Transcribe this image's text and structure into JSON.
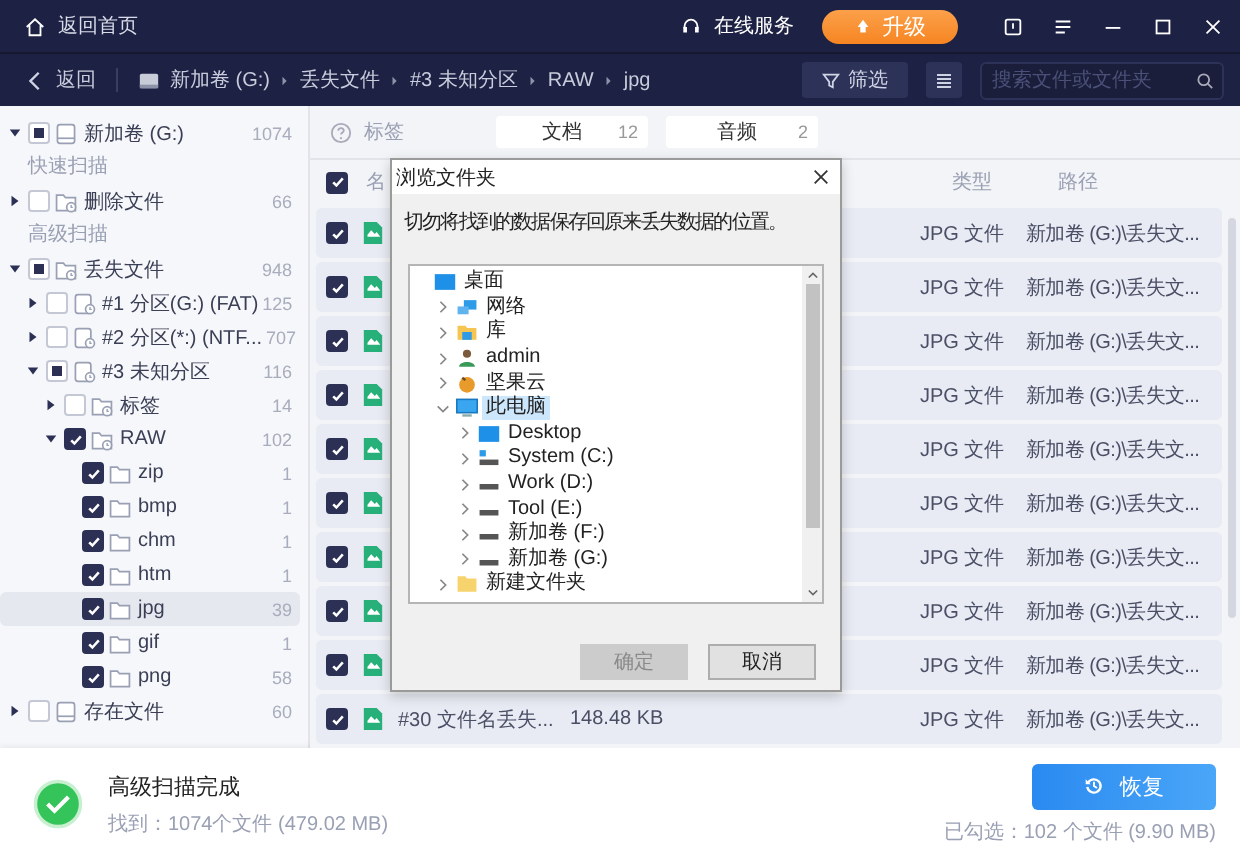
{
  "title_bar": {
    "home_link": "返回首页",
    "service": "在线服务",
    "upgrade_button": "升级"
  },
  "nav_bar": {
    "back": "返回",
    "breadcrumb": [
      "新加卷 (G:)",
      "丢失文件",
      "#3 未知分区",
      "RAW",
      "jpg"
    ],
    "filter_button": "筛选",
    "search": {
      "placeholder": "搜索文件或文件夹"
    }
  },
  "sidebar": {
    "items": [
      {
        "kind": "drive",
        "label": "新加卷 (G:)",
        "count": "1074",
        "partial": true,
        "expanded": true,
        "selected": false
      },
      {
        "kind": "heading",
        "label": "快速扫描"
      },
      {
        "kind": "folder-clock",
        "label": "删除文件",
        "count": "66",
        "checked": false,
        "expanded": false,
        "selected": false
      },
      {
        "kind": "heading",
        "label": "高级扫描"
      },
      {
        "kind": "folder-clock",
        "label": "丢失文件",
        "count": "948",
        "partial": true,
        "expanded": true,
        "selected": false,
        "children": [
          {
            "kind": "drive-clock",
            "label": "#1 分区(G:) (FAT)",
            "count": "125",
            "checked": false,
            "expanded": false,
            "selected": false
          },
          {
            "kind": "drive-clock",
            "label": "#2 分区(*:) (NTF...",
            "count": "707",
            "checked": false,
            "expanded": false,
            "selected": false
          },
          {
            "kind": "drive-clock",
            "label": "#3 未知分区",
            "count": "116",
            "partial": true,
            "expanded": true,
            "selected": false,
            "children": [
              {
                "kind": "folder-clock",
                "label": "标签",
                "count": "14",
                "checked": false,
                "expanded": false,
                "selected": false
              },
              {
                "kind": "folder-clock",
                "label": "RAW",
                "count": "102",
                "checked": true,
                "expanded": true,
                "selected": false,
                "children": [
                  {
                    "kind": "folder",
                    "label": "zip",
                    "count": "1",
                    "checked": true,
                    "selected": false
                  },
                  {
                    "kind": "folder",
                    "label": "bmp",
                    "count": "1",
                    "checked": true,
                    "selected": false
                  },
                  {
                    "kind": "folder",
                    "label": "chm",
                    "count": "1",
                    "checked": true,
                    "selected": false
                  },
                  {
                    "kind": "folder",
                    "label": "htm",
                    "count": "1",
                    "checked": true,
                    "selected": false
                  },
                  {
                    "kind": "folder",
                    "label": "jpg",
                    "count": "39",
                    "checked": true,
                    "selected": true
                  },
                  {
                    "kind": "folder",
                    "label": "gif",
                    "count": "1",
                    "checked": true,
                    "selected": false
                  },
                  {
                    "kind": "folder",
                    "label": "png",
                    "count": "58",
                    "checked": true,
                    "selected": false
                  }
                ]
              }
            ]
          }
        ]
      },
      {
        "kind": "drive",
        "label": "存在文件",
        "count": "60",
        "checked": false,
        "expanded": false,
        "selected": false
      }
    ]
  },
  "tags": {
    "label": "标签",
    "items": [
      {
        "label": "文档",
        "count": "12"
      },
      {
        "label": "音频",
        "count": "2"
      }
    ]
  },
  "table": {
    "all_checked": true,
    "columns": [
      "名",
      "类型",
      "路径"
    ],
    "rows": [
      {
        "checked": true,
        "type": "JPG 文件",
        "path": "新加卷 (G:)\\丢失文..."
      },
      {
        "checked": true,
        "type": "JPG 文件",
        "path": "新加卷 (G:)\\丢失文..."
      },
      {
        "checked": true,
        "type": "JPG 文件",
        "path": "新加卷 (G:)\\丢失文..."
      },
      {
        "checked": true,
        "type": "JPG 文件",
        "path": "新加卷 (G:)\\丢失文..."
      },
      {
        "checked": true,
        "type": "JPG 文件",
        "path": "新加卷 (G:)\\丢失文..."
      },
      {
        "checked": true,
        "type": "JPG 文件",
        "path": "新加卷 (G:)\\丢失文..."
      },
      {
        "checked": true,
        "type": "JPG 文件",
        "path": "新加卷 (G:)\\丢失文..."
      },
      {
        "checked": true,
        "type": "JPG 文件",
        "path": "新加卷 (G:)\\丢失文..."
      },
      {
        "checked": true,
        "type": "JPG 文件",
        "path": "新加卷 (G:)\\丢失文..."
      },
      {
        "checked": true,
        "name": "#30 文件名丢失...",
        "size": "148.48 KB",
        "type": "JPG 文件",
        "path": "新加卷 (G:)\\丢失文..."
      }
    ]
  },
  "dialog": {
    "title": "浏览文件夹",
    "message": "切勿将找到的数据保存回原来丢失数据的位置。",
    "tree": [
      {
        "kind": "desktop",
        "label": "桌面",
        "selected": false,
        "children": [
          {
            "kind": "network",
            "label": "网络",
            "expanded": false,
            "selected": false
          },
          {
            "kind": "library",
            "label": "库",
            "expanded": false,
            "selected": false
          },
          {
            "kind": "user",
            "label": "admin",
            "expanded": false,
            "selected": false
          },
          {
            "kind": "cloud",
            "label": "坚果云",
            "expanded": false,
            "selected": false
          },
          {
            "kind": "computer",
            "label": "此电脑",
            "expanded": true,
            "selected": true,
            "children": [
              {
                "kind": "desktop",
                "label": "Desktop",
                "expanded": false,
                "selected": false
              },
              {
                "kind": "system-drive",
                "label": "System (C:)",
                "expanded": false,
                "selected": false
              },
              {
                "kind": "drive",
                "label": "Work (D:)",
                "expanded": false,
                "selected": false
              },
              {
                "kind": "drive",
                "label": "Tool (E:)",
                "expanded": false,
                "selected": false
              },
              {
                "kind": "drive",
                "label": "新加卷 (F:)",
                "expanded": false,
                "selected": false
              },
              {
                "kind": "drive",
                "label": "新加卷 (G:)",
                "expanded": false,
                "selected": false
              }
            ]
          },
          {
            "kind": "folder",
            "label": "新建文件夹",
            "expanded": false,
            "selected": false
          }
        ]
      }
    ],
    "ok_button": {
      "label": "确定",
      "disabled": true
    },
    "cancel_button": {
      "label": "取消",
      "disabled": false
    }
  },
  "footer": {
    "status": "高级扫描完成",
    "found": "找到：1074个文件 (479.02 MB)",
    "recover_button": "恢复",
    "selected_summary": "已勾选：102 个文件 (9.90 MB)"
  }
}
